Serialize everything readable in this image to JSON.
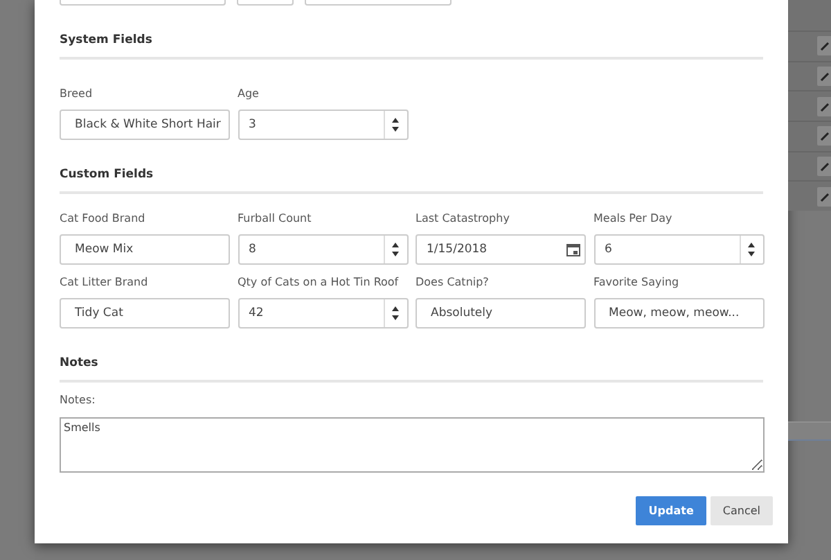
{
  "sections": [
    {
      "title": "System Fields",
      "fields": [
        {
          "label": "Breed",
          "value": "Black & White Short Hair",
          "kind": "text"
        },
        {
          "label": "Age",
          "value": "3",
          "kind": "number"
        }
      ]
    },
    {
      "title": "Custom Fields",
      "fields": [
        {
          "label": "Cat Food Brand",
          "value": "Meow Mix",
          "kind": "text"
        },
        {
          "label": "Furball Count",
          "value": "8",
          "kind": "number"
        },
        {
          "label": "Last Catastrophy",
          "value": "1/15/2018",
          "kind": "date"
        },
        {
          "label": "Meals Per Day",
          "value": "6",
          "kind": "number"
        },
        {
          "label": "Cat Litter Brand",
          "value": "Tidy Cat",
          "kind": "text"
        },
        {
          "label": "Qty of Cats on a Hot Tin Roof",
          "value": "42",
          "kind": "number"
        },
        {
          "label": "Does Catnip?",
          "value": "Absolutely",
          "kind": "text"
        },
        {
          "label": "Favorite Saying",
          "value": "Meow, meow, meow...",
          "kind": "text"
        }
      ]
    },
    {
      "title": "Notes",
      "fields": [
        {
          "label": "Notes:",
          "value": "Smells",
          "kind": "textarea"
        }
      ]
    }
  ],
  "buttons": [
    {
      "label": "Update",
      "kind": "primary"
    },
    {
      "label": "Cancel",
      "kind": "secondary"
    }
  ]
}
